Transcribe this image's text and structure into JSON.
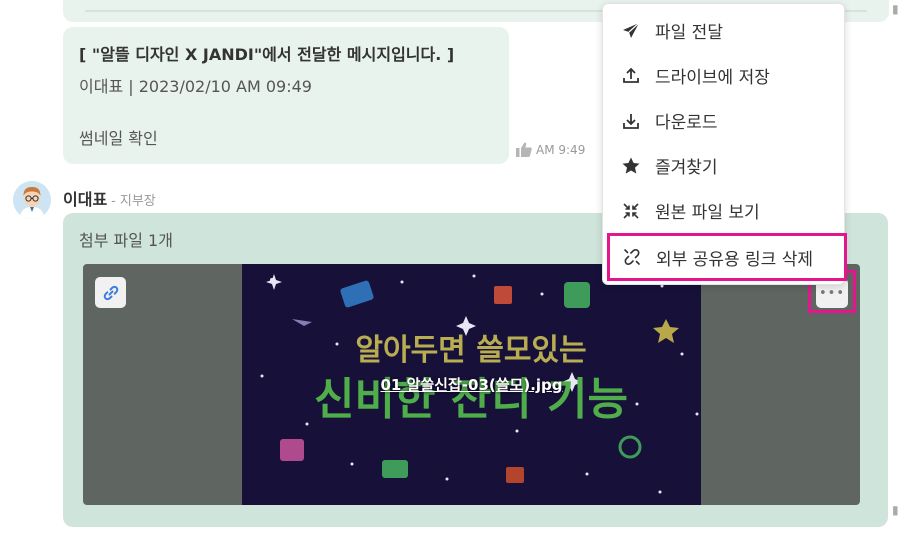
{
  "quoted_message": {
    "title": "[ \"알뜰 디자인 X JANDI\"에서 전달한 메시지입니다. ]",
    "meta": "이대표 | 2023/02/10 AM 09:49",
    "body": "썸네일 확인",
    "time": "AM 9:49"
  },
  "sender": {
    "name": "이대표",
    "separator": "-",
    "role": "지부장"
  },
  "attachment": {
    "label": "첨부 파일 1개",
    "file_name": "01 알쓸신잡-03(쓸모).jpg",
    "poster_line1": "알아두면 쓸모있는",
    "poster_line2": "신비한 잔디 기능"
  },
  "context_menu": {
    "items": [
      {
        "label": "파일 전달",
        "icon": "send-icon"
      },
      {
        "label": "드라이브에 저장",
        "icon": "upload-icon"
      },
      {
        "label": "다운로드",
        "icon": "download-icon"
      },
      {
        "label": "즐겨찾기",
        "icon": "star-icon"
      },
      {
        "label": "원본 파일 보기",
        "icon": "collapse-arrows-icon"
      },
      {
        "label": "외부 공유용 링크 삭제",
        "icon": "link-off-icon"
      }
    ]
  },
  "colors": {
    "bubble": "#e9f3ee",
    "attachment_bubble": "#cfe4da",
    "highlight": "#e5158e"
  }
}
